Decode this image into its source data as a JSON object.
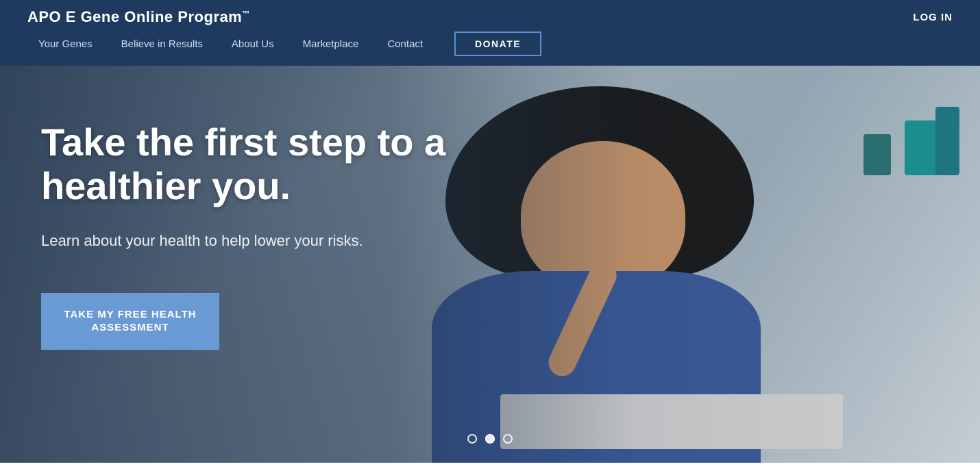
{
  "header": {
    "logo": "APO E Gene Online Program",
    "logo_tm": "™",
    "login_label": "LOG IN",
    "nav_items": [
      {
        "label": "Your Genes"
      },
      {
        "label": "Believe in Results"
      },
      {
        "label": "About Us"
      },
      {
        "label": "Marketplace"
      },
      {
        "label": "Contact"
      }
    ],
    "donate_label": "DONATE"
  },
  "hero": {
    "title": "Take the first step to a healthier you.",
    "subtitle": "Learn about your health to help lower your risks.",
    "cta_label": "TAKE MY FREE HEALTH ASSESSMENT",
    "carousel_dots": [
      {
        "state": "inactive"
      },
      {
        "state": "active"
      },
      {
        "state": "inactive"
      }
    ]
  },
  "colors": {
    "nav_bg": "#1e3a5f",
    "cta_bg": "#6a9ad4",
    "donate_border": "#5b8dd9"
  }
}
